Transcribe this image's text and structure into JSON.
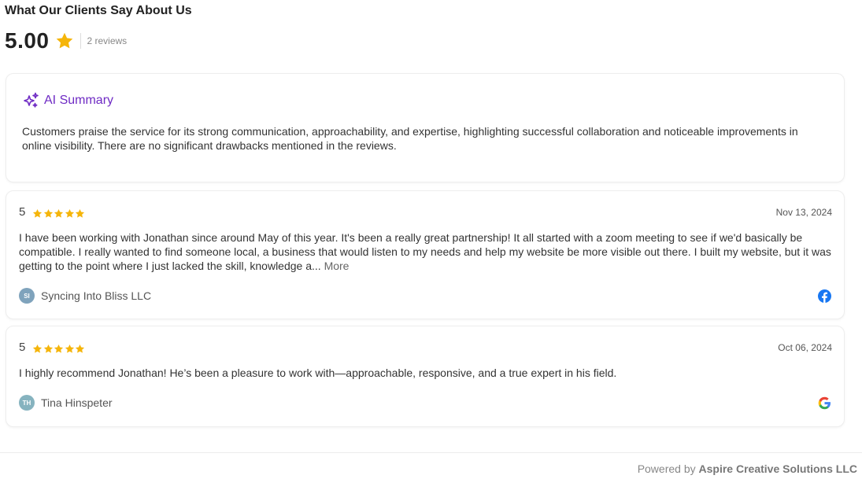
{
  "header": {
    "title": "What Our Clients Say About Us",
    "rating": "5.00",
    "review_count": "2 reviews"
  },
  "ai_summary": {
    "title": "AI Summary",
    "text": "Customers praise the service for its strong communication, approachability, and expertise, highlighting successful collaboration and noticeable improvements in online visibility. There are no significant drawbacks mentioned in the reviews."
  },
  "reviews": [
    {
      "score": "5",
      "stars": 5,
      "date": "Nov 13, 2024",
      "text": "I have been working with Jonathan since around May of this year. It's been a really great partnership! It all started with a zoom meeting to see if we'd basically be compatible. I really wanted to find someone local, a business that would listen to my needs and help my website be more visible out there. I built my website, but it was getting to the point where I just lacked the skill, knowledge a...",
      "more_label": "More",
      "author_initials": "SI",
      "author_name": "Syncing Into Bliss LLC",
      "source_icon": "facebook-icon"
    },
    {
      "score": "5",
      "stars": 5,
      "date": "Oct 06, 2024",
      "text": "I highly recommend Jonathan! He’s been a pleasure to work with—approachable, responsive, and a true expert in his field.",
      "author_initials": "TH",
      "author_name": "Tina Hinspeter",
      "source_icon": "google-icon"
    }
  ],
  "footer": {
    "powered_by": "Powered by",
    "brand": "Aspire Creative Solutions LLC"
  },
  "colors": {
    "star": "#f5b50a",
    "ai_purple": "#6f2bc4",
    "facebook_blue": "#1877f2"
  }
}
